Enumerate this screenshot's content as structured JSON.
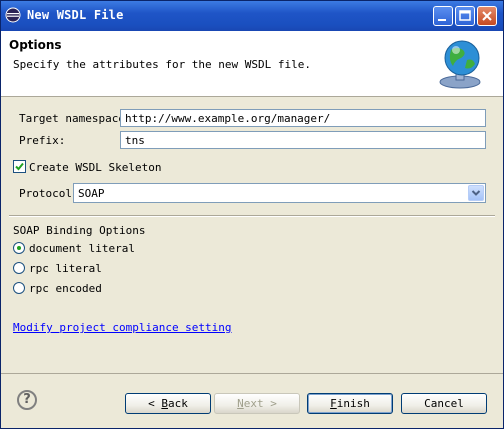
{
  "window": {
    "title": "New WSDL File",
    "controls": {
      "minimize": "minimize-icon",
      "maximize": "maximize-icon",
      "close": "close-icon"
    }
  },
  "header": {
    "title": "Options",
    "description": "Specify the attributes for the new WSDL file.",
    "icon": "wsdl-globe-icon"
  },
  "form": {
    "target_namespace_label": "Target namespace:",
    "target_namespace_value": "http://www.example.org/manager/",
    "prefix_label": "Prefix:",
    "prefix_value": "tns",
    "create_skeleton_label": "Create WSDL Skeleton",
    "create_skeleton_checked": true,
    "protocol_label": "Protocol:",
    "protocol_value": "SOAP"
  },
  "binding": {
    "heading": "SOAP Binding Options",
    "options": [
      {
        "label": "document literal",
        "selected": true
      },
      {
        "label": "rpc literal",
        "selected": false
      },
      {
        "label": "rpc encoded",
        "selected": false
      }
    ]
  },
  "link": "Modify project compliance setting",
  "footer": {
    "back_underline": "B",
    "back_rest": "ack",
    "next_underline": "N",
    "next_rest": "ext >",
    "finish_underline": "F",
    "finish_rest": "inish",
    "cancel": "Cancel",
    "help_glyph": "?"
  },
  "colors": {
    "titlebar": "#1f55c7",
    "link": "#0000ff",
    "dialog_bg": "#ece9d8"
  }
}
